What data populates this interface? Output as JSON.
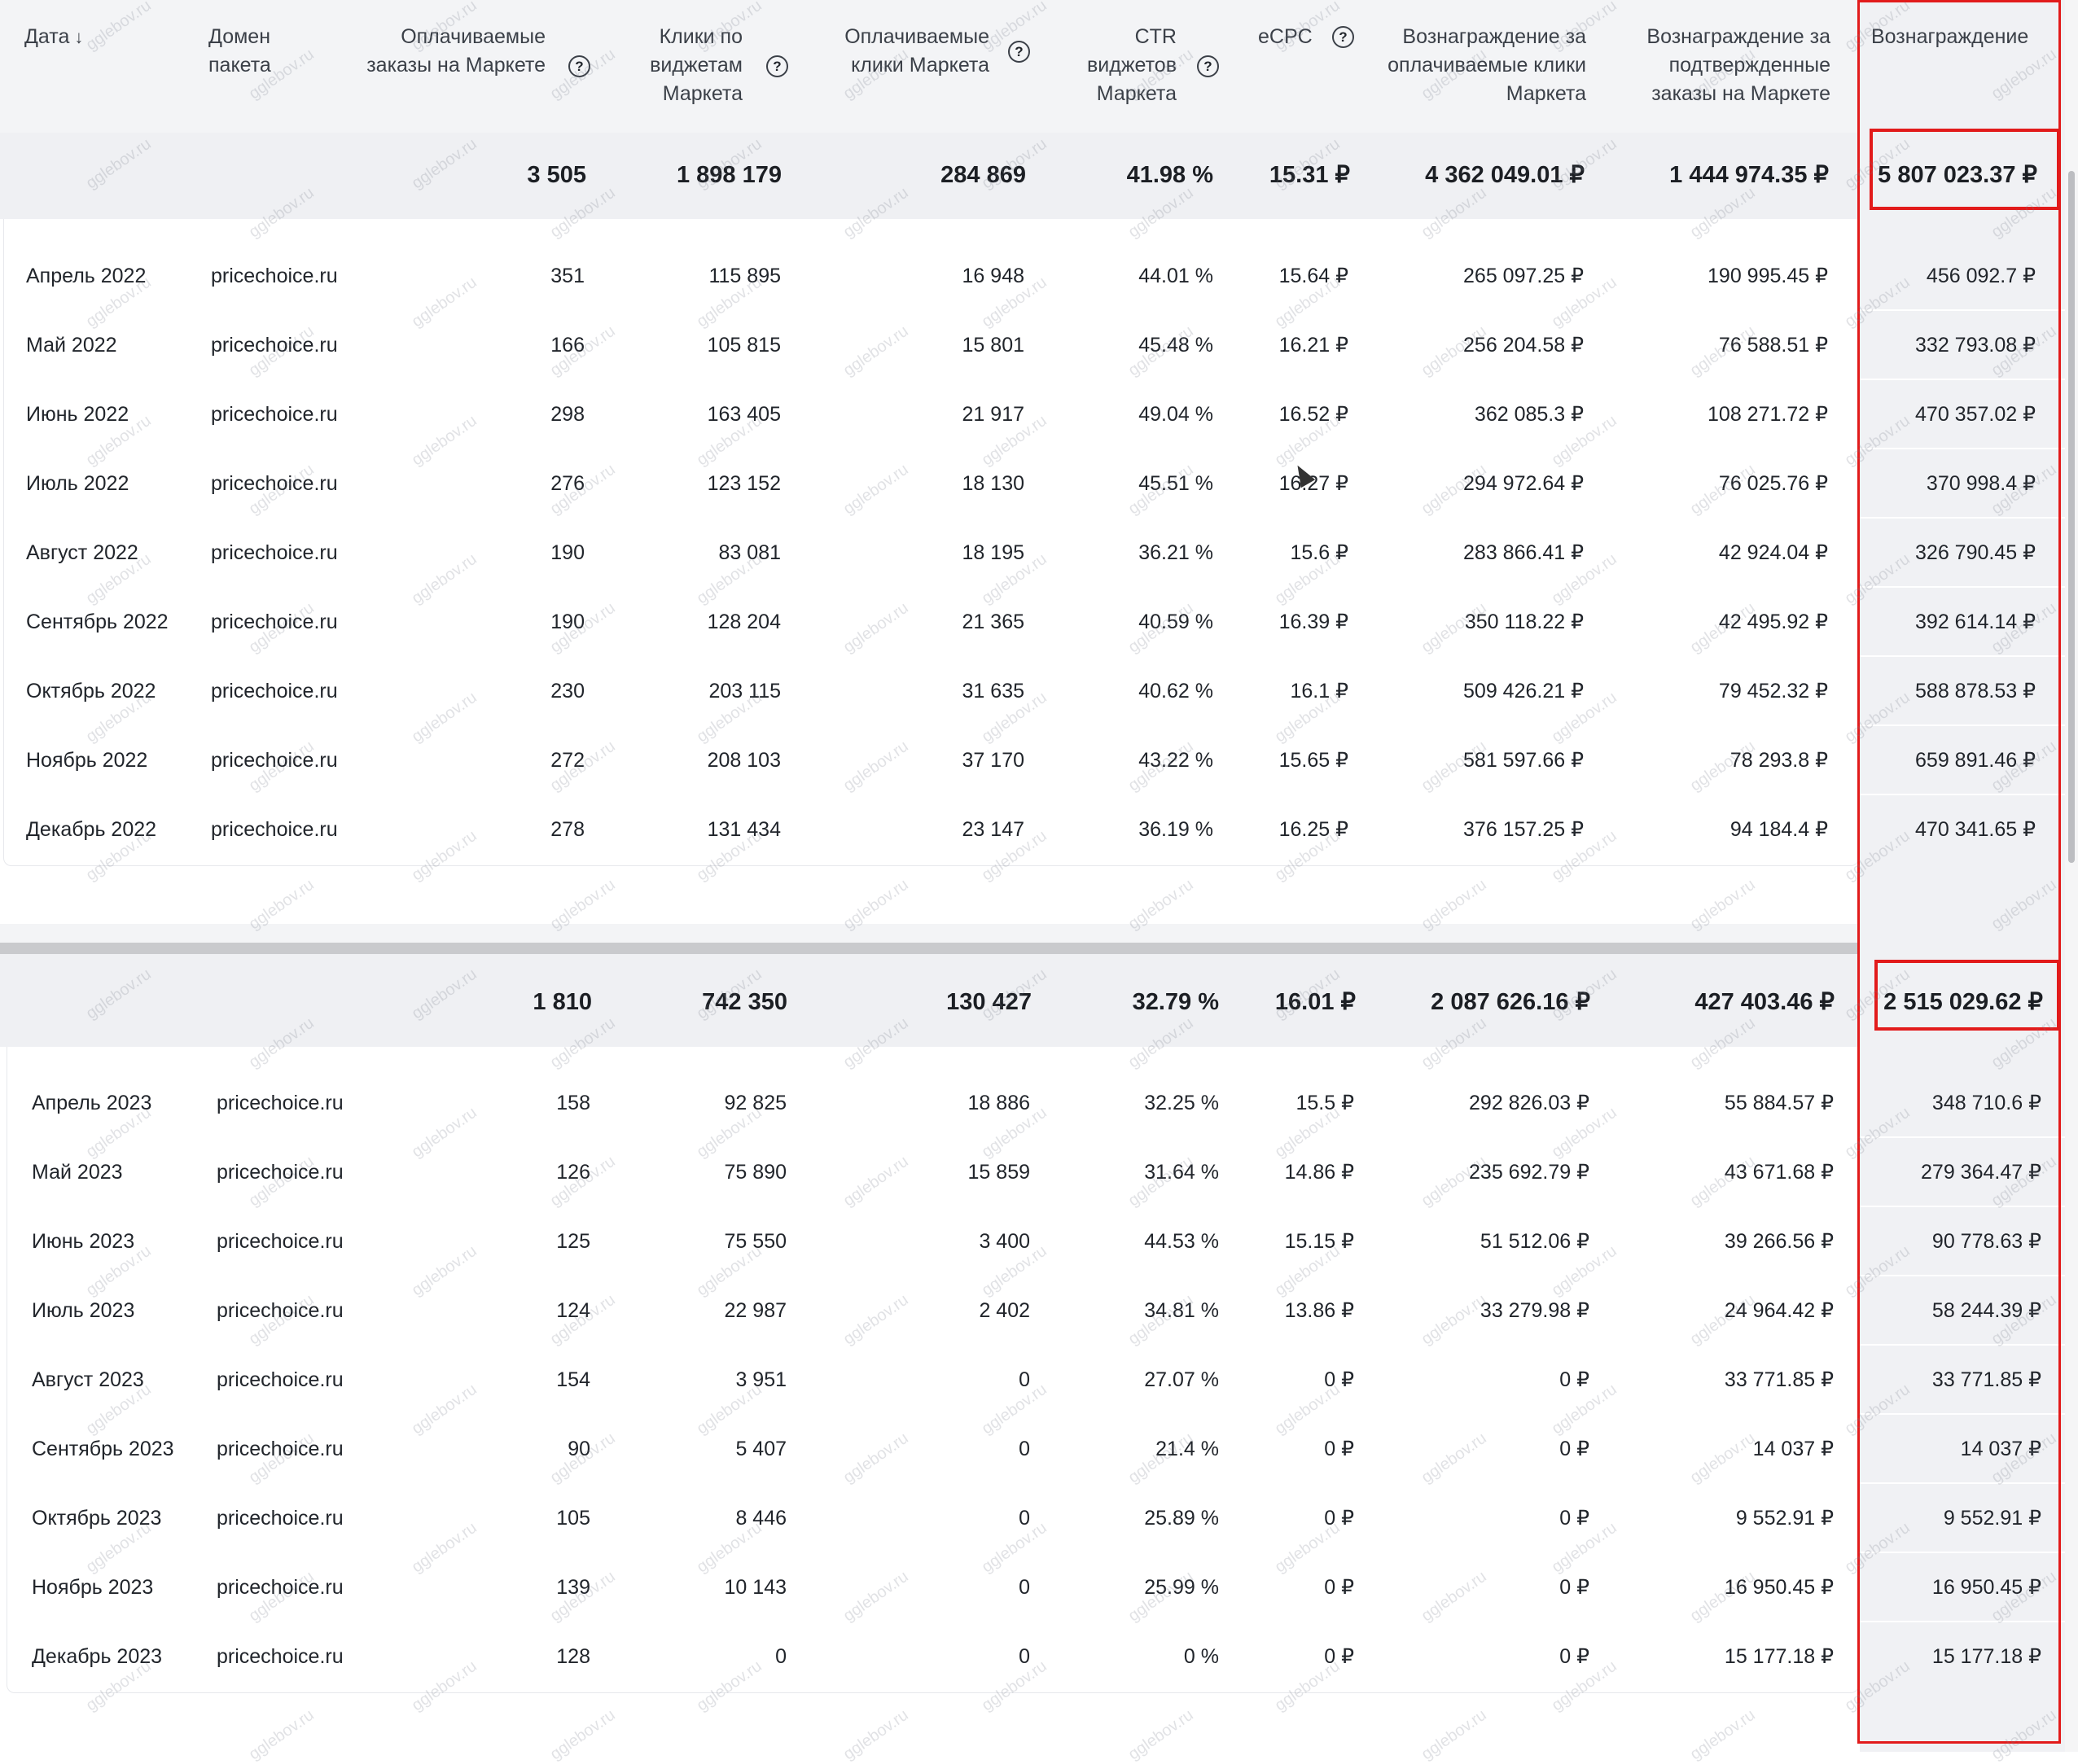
{
  "table": {
    "headers": {
      "date": "Дата",
      "domain": "Домен пакета",
      "orders": "Оплачиваемые заказы на Маркете",
      "widget_clicks": "Клики по виджетам Маркета",
      "paid_clicks": "Оплачиваемые клики Маркета",
      "ctr": "CTR виджетов Маркета",
      "ecpc": "eCPC",
      "reward_clicks": "Вознаграждение за оплачиваемые клики Маркета",
      "reward_orders": "Вознаграждение за подтвержденные заказы на Маркете",
      "reward": "Вознаграждение"
    },
    "sort_icon": "arrow-down-icon",
    "help_icon": "question-circle-icon"
  },
  "sections": [
    {
      "totals": {
        "orders": "3 505",
        "widget_clicks": "1 898 179",
        "paid_clicks": "284 869",
        "ctr": "41.98 %",
        "ecpc": "15.31 ₽",
        "reward_clicks": "4 362 049.01 ₽",
        "reward_orders": "1 444 974.35 ₽",
        "reward": "5 807 023.37 ₽"
      },
      "rows": [
        {
          "date": "Апрель 2022",
          "domain": "pricechoice.ru",
          "orders": "351",
          "widget_clicks": "115 895",
          "paid_clicks": "16 948",
          "ctr": "44.01 %",
          "ecpc": "15.64 ₽",
          "reward_clicks": "265 097.25 ₽",
          "reward_orders": "190 995.45 ₽",
          "reward": "456 092.7 ₽"
        },
        {
          "date": "Май 2022",
          "domain": "pricechoice.ru",
          "orders": "166",
          "widget_clicks": "105 815",
          "paid_clicks": "15 801",
          "ctr": "45.48 %",
          "ecpc": "16.21 ₽",
          "reward_clicks": "256 204.58 ₽",
          "reward_orders": "76 588.51 ₽",
          "reward": "332 793.08 ₽"
        },
        {
          "date": "Июнь 2022",
          "domain": "pricechoice.ru",
          "orders": "298",
          "widget_clicks": "163 405",
          "paid_clicks": "21 917",
          "ctr": "49.04 %",
          "ecpc": "16.52 ₽",
          "reward_clicks": "362 085.3 ₽",
          "reward_orders": "108 271.72 ₽",
          "reward": "470 357.02 ₽"
        },
        {
          "date": "Июль 2022",
          "domain": "pricechoice.ru",
          "orders": "276",
          "widget_clicks": "123 152",
          "paid_clicks": "18 130",
          "ctr": "45.51 %",
          "ecpc": "16.27 ₽",
          "reward_clicks": "294 972.64 ₽",
          "reward_orders": "76 025.76 ₽",
          "reward": "370 998.4 ₽"
        },
        {
          "date": "Август 2022",
          "domain": "pricechoice.ru",
          "orders": "190",
          "widget_clicks": "83 081",
          "paid_clicks": "18 195",
          "ctr": "36.21 %",
          "ecpc": "15.6 ₽",
          "reward_clicks": "283 866.41 ₽",
          "reward_orders": "42 924.04 ₽",
          "reward": "326 790.45 ₽"
        },
        {
          "date": "Сентябрь 2022",
          "domain": "pricechoice.ru",
          "orders": "190",
          "widget_clicks": "128 204",
          "paid_clicks": "21 365",
          "ctr": "40.59 %",
          "ecpc": "16.39 ₽",
          "reward_clicks": "350 118.22 ₽",
          "reward_orders": "42 495.92 ₽",
          "reward": "392 614.14 ₽"
        },
        {
          "date": "Октябрь 2022",
          "domain": "pricechoice.ru",
          "orders": "230",
          "widget_clicks": "203 115",
          "paid_clicks": "31 635",
          "ctr": "40.62 %",
          "ecpc": "16.1 ₽",
          "reward_clicks": "509 426.21 ₽",
          "reward_orders": "79 452.32 ₽",
          "reward": "588 878.53 ₽"
        },
        {
          "date": "Ноябрь 2022",
          "domain": "pricechoice.ru",
          "orders": "272",
          "widget_clicks": "208 103",
          "paid_clicks": "37 170",
          "ctr": "43.22 %",
          "ecpc": "15.65 ₽",
          "reward_clicks": "581 597.66 ₽",
          "reward_orders": "78 293.8 ₽",
          "reward": "659 891.46 ₽"
        },
        {
          "date": "Декабрь 2022",
          "domain": "pricechoice.ru",
          "orders": "278",
          "widget_clicks": "131 434",
          "paid_clicks": "23 147",
          "ctr": "36.19 %",
          "ecpc": "16.25 ₽",
          "reward_clicks": "376 157.25 ₽",
          "reward_orders": "94 184.4 ₽",
          "reward": "470 341.65 ₽"
        }
      ]
    },
    {
      "totals": {
        "orders": "1 810",
        "widget_clicks": "742 350",
        "paid_clicks": "130 427",
        "ctr": "32.79 %",
        "ecpc": "16.01 ₽",
        "reward_clicks": "2 087 626.16 ₽",
        "reward_orders": "427 403.46 ₽",
        "reward": "2 515 029.62 ₽"
      },
      "rows": [
        {
          "date": "Апрель 2023",
          "domain": "pricechoice.ru",
          "orders": "158",
          "widget_clicks": "92 825",
          "paid_clicks": "18 886",
          "ctr": "32.25 %",
          "ecpc": "15.5 ₽",
          "reward_clicks": "292 826.03 ₽",
          "reward_orders": "55 884.57 ₽",
          "reward": "348 710.6 ₽"
        },
        {
          "date": "Май 2023",
          "domain": "pricechoice.ru",
          "orders": "126",
          "widget_clicks": "75 890",
          "paid_clicks": "15 859",
          "ctr": "31.64 %",
          "ecpc": "14.86 ₽",
          "reward_clicks": "235 692.79 ₽",
          "reward_orders": "43 671.68 ₽",
          "reward": "279 364.47 ₽"
        },
        {
          "date": "Июнь 2023",
          "domain": "pricechoice.ru",
          "orders": "125",
          "widget_clicks": "75 550",
          "paid_clicks": "3 400",
          "ctr": "44.53 %",
          "ecpc": "15.15 ₽",
          "reward_clicks": "51 512.06 ₽",
          "reward_orders": "39 266.56 ₽",
          "reward": "90 778.63 ₽"
        },
        {
          "date": "Июль 2023",
          "domain": "pricechoice.ru",
          "orders": "124",
          "widget_clicks": "22 987",
          "paid_clicks": "2 402",
          "ctr": "34.81 %",
          "ecpc": "13.86 ₽",
          "reward_clicks": "33 279.98 ₽",
          "reward_orders": "24 964.42 ₽",
          "reward": "58 244.39 ₽"
        },
        {
          "date": "Август 2023",
          "domain": "pricechoice.ru",
          "orders": "154",
          "widget_clicks": "3 951",
          "paid_clicks": "0",
          "ctr": "27.07 %",
          "ecpc": "0 ₽",
          "reward_clicks": "0 ₽",
          "reward_orders": "33 771.85 ₽",
          "reward": "33 771.85 ₽"
        },
        {
          "date": "Сентябрь 2023",
          "domain": "pricechoice.ru",
          "orders": "90",
          "widget_clicks": "5 407",
          "paid_clicks": "0",
          "ctr": "21.4 %",
          "ecpc": "0 ₽",
          "reward_clicks": "0 ₽",
          "reward_orders": "14 037 ₽",
          "reward": "14 037 ₽"
        },
        {
          "date": "Октябрь 2023",
          "domain": "pricechoice.ru",
          "orders": "105",
          "widget_clicks": "8 446",
          "paid_clicks": "0",
          "ctr": "25.89 %",
          "ecpc": "0 ₽",
          "reward_clicks": "0 ₽",
          "reward_orders": "9 552.91 ₽",
          "reward": "9 552.91 ₽"
        },
        {
          "date": "Ноябрь 2023",
          "domain": "pricechoice.ru",
          "orders": "139",
          "widget_clicks": "10 143",
          "paid_clicks": "0",
          "ctr": "25.99 %",
          "ecpc": "0 ₽",
          "reward_clicks": "0 ₽",
          "reward_orders": "16 950.45 ₽",
          "reward": "16 950.45 ₽"
        },
        {
          "date": "Декабрь 2023",
          "domain": "pricechoice.ru",
          "orders": "128",
          "widget_clicks": "0",
          "paid_clicks": "0",
          "ctr": "0 %",
          "ecpc": "0 ₽",
          "reward_clicks": "0 ₽",
          "reward_orders": "15 177.18 ₽",
          "reward": "15 177.18 ₽"
        }
      ]
    }
  ],
  "watermark": "gglebov.ru",
  "colors": {
    "highlight": "#e21b1b",
    "header_bg": "#f3f4f6",
    "total_bg": "#eff0f3"
  }
}
